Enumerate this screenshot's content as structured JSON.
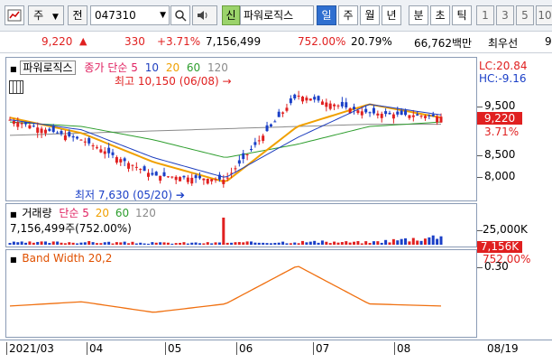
{
  "toolbar": {
    "menu_icon": "chart-menu-icon",
    "market_select": "주",
    "prev_label": "전",
    "code_value": "047310",
    "stock_name": "파워로직스",
    "new_label": "신",
    "period_tabs": [
      "일",
      "주",
      "월",
      "년",
      "분",
      "초",
      "틱"
    ],
    "active_period": "일",
    "multiplier_tabs": [
      "1",
      "3",
      "5",
      "10"
    ]
  },
  "quote": {
    "price": "9,220",
    "change": "330",
    "change_pct": "+3.71%",
    "volume": "7,156,499",
    "volume_ratio": "752.00%",
    "turnover": "20.79%",
    "trade_amount": "66,762백만",
    "priority_label": "최우선",
    "tail": "9"
  },
  "price_panel": {
    "stock_label": "파워로직스",
    "ma_title": "종가 단순",
    "ma_periods": [
      "5",
      "10",
      "20",
      "60",
      "120"
    ],
    "high_note": "최고 10,150 (06/08)",
    "low_note": "최저 7,630 (05/20)",
    "lc_label": "LC:20.84",
    "hc_label": "HC:-9.16",
    "y_labels": [
      "9,500",
      "8,500",
      "8,000"
    ],
    "current_price_badge": "9,220",
    "current_pct_badge": "3.71%",
    "colors": {
      "ma5": "#f0a000",
      "ma10": "#1f3fbf",
      "ma20": "#f0a000",
      "ma60": "#2e9e2e",
      "ma120": "#8a8a8a",
      "up": "#e02020",
      "down": "#1a3fc7"
    }
  },
  "volume_panel": {
    "title": "거래량",
    "ma_title": "단순",
    "ma_periods": [
      "5",
      "20",
      "60",
      "120"
    ],
    "value_note": "7,156,499주(752.00%)",
    "y_label": "25,000K",
    "current_badge": "7,156K",
    "pct_badge": "752.00%"
  },
  "band_panel": {
    "title": "Band Width 20,2",
    "y_label": "0.30"
  },
  "x_axis": {
    "labels": [
      "2021/03",
      "04",
      "05",
      "06",
      "07",
      "08"
    ],
    "end_label": "08/19"
  },
  "chart_data": [
    {
      "type": "line",
      "title": "",
      "xlabel": "",
      "ylabel": "",
      "x": [
        "2021/03",
        "04",
        "05",
        "06",
        "07",
        "08",
        "08/19"
      ],
      "ylim": [
        7500,
        10300
      ],
      "series": [
        {
          "name": "종가",
          "values": [
            9150,
            8700,
            7900,
            7800,
            9700,
            9300,
            9220
          ]
        },
        {
          "name": "20",
          "values": [
            9200,
            8850,
            8200,
            7750,
            9000,
            9500,
            9200
          ]
        },
        {
          "name": "60",
          "values": [
            9100,
            9000,
            8700,
            8300,
            8600,
            9000,
            9100
          ]
        },
        {
          "name": "120",
          "values": [
            8800,
            8850,
            8900,
            8950,
            9000,
            9050,
            9050
          ]
        }
      ]
    },
    {
      "type": "bar",
      "title": "거래량",
      "x": [
        "2021/03",
        "04",
        "05",
        "06",
        "07",
        "08",
        "08/19"
      ],
      "values": [
        1800,
        2200,
        1500,
        1600,
        2500,
        2100,
        7156
      ],
      "ylim": [
        0,
        30000
      ]
    },
    {
      "type": "line",
      "title": "Band Width 20,2",
      "x": [
        "2021/03",
        "04",
        "05",
        "06",
        "07",
        "08",
        "08/19"
      ],
      "values": [
        0.12,
        0.14,
        0.09,
        0.13,
        0.31,
        0.13,
        0.12
      ],
      "ylim": [
        0.0,
        0.35
      ]
    }
  ]
}
